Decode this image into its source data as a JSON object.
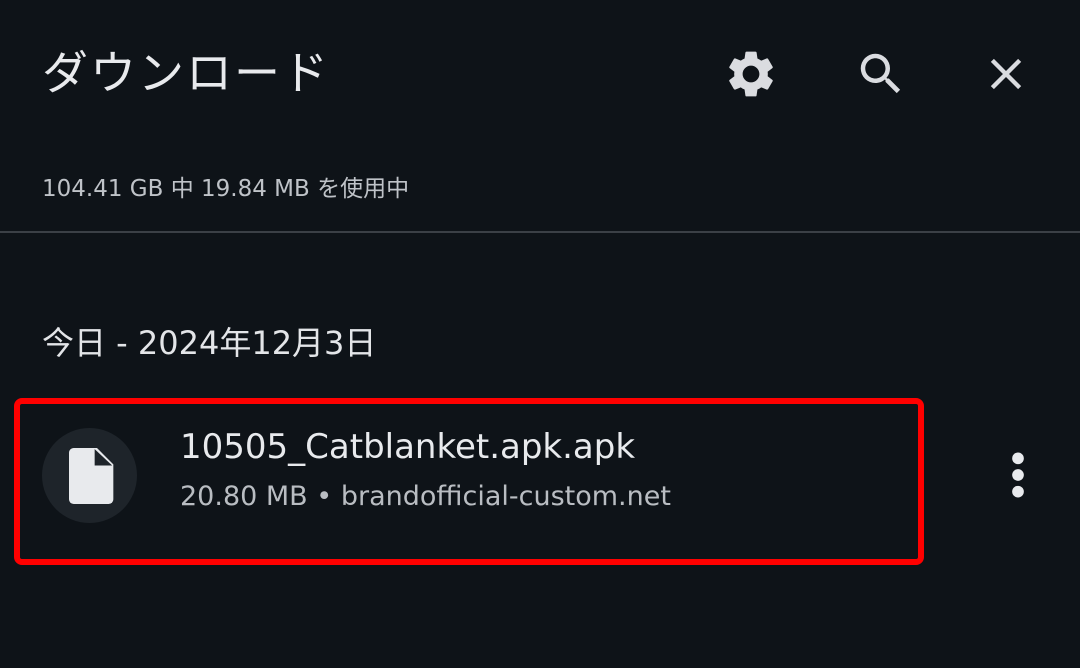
{
  "header": {
    "title": "ダウンロード",
    "icons": [
      "gear-icon",
      "search-icon",
      "close-icon"
    ]
  },
  "storage": {
    "usage_text": "104.41 GB 中 19.84 MB を使用中"
  },
  "downloads": {
    "section_label": "今日 - 2024年12月3日",
    "items": [
      {
        "file_name": "10505_Catblanket.apk.apk",
        "size": "20.80 MB",
        "separator": "•",
        "source": "brandofficial-custom.net",
        "icon": "file-icon",
        "menu_icon": "more-vert-icon"
      }
    ]
  },
  "colors": {
    "background": "#0e1318",
    "text_primary": "#e8eaed",
    "text_secondary": "#b9bdc2",
    "divider": "#3b4046",
    "highlight": "#ff0000",
    "icon": "#dadce0"
  }
}
